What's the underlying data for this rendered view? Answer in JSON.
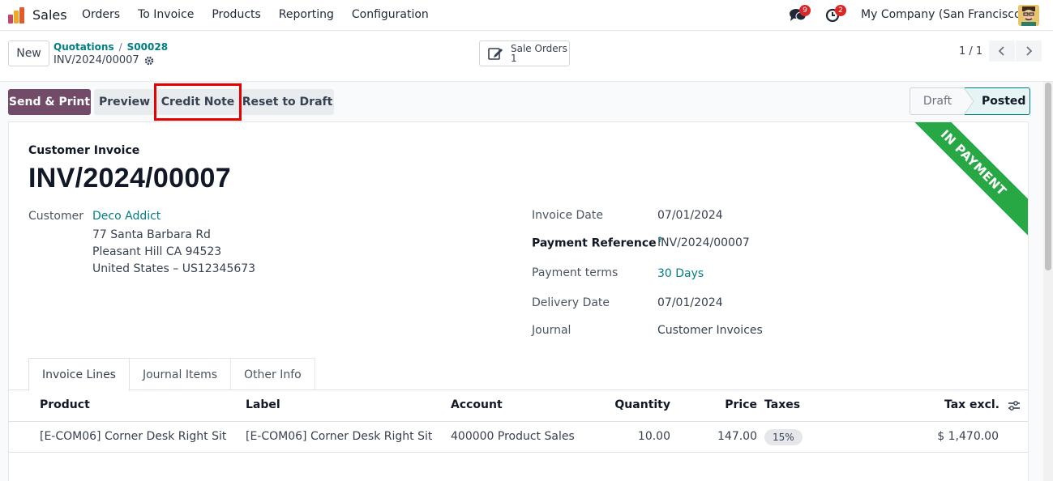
{
  "navbar": {
    "app_name": "Sales",
    "menu": [
      "Orders",
      "To Invoice",
      "Products",
      "Reporting",
      "Configuration"
    ],
    "messages_badge": "9",
    "activities_badge": "2",
    "company": "My Company (San Francisco)"
  },
  "control": {
    "new_label": "New",
    "breadcrumb": [
      "Quotations",
      "S00028"
    ],
    "record_name": "INV/2024/00007",
    "smart_button": {
      "label": "Sale Orders",
      "count": "1"
    },
    "pager": "1 / 1"
  },
  "actions": {
    "send_print": "Send & Print",
    "preview": "Preview",
    "credit_note": "Credit Note",
    "reset_draft": "Reset to Draft"
  },
  "status": {
    "stages": [
      "Draft",
      "Posted"
    ],
    "current": "Posted"
  },
  "sheet": {
    "ribbon": "IN PAYMENT",
    "doc_type": "Customer Invoice",
    "title": "INV/2024/00007",
    "customer_label": "Customer",
    "customer_name": "Deco Addict",
    "address": [
      "77 Santa Barbara Rd",
      "Pleasant Hill CA 94523",
      "United States – US12345673"
    ],
    "fields": {
      "invoice_date": {
        "label": "Invoice Date",
        "value": "07/01/2024"
      },
      "payment_reference": {
        "label": "Payment Reference",
        "help": "?",
        "value": "INV/2024/00007"
      },
      "payment_terms": {
        "label": "Payment terms",
        "value": "30 Days"
      },
      "delivery_date": {
        "label": "Delivery Date",
        "value": "07/01/2024"
      },
      "journal": {
        "label": "Journal",
        "value": "Customer Invoices"
      }
    }
  },
  "tabs": [
    "Invoice Lines",
    "Journal Items",
    "Other Info"
  ],
  "table": {
    "headers": {
      "product": "Product",
      "label": "Label",
      "account": "Account",
      "quantity": "Quantity",
      "price": "Price",
      "taxes": "Taxes",
      "tax_excl": "Tax excl."
    },
    "rows": [
      {
        "product": "[E-COM06] Corner Desk Right Sit",
        "label": "[E-COM06] Corner Desk Right Sit",
        "account": "400000 Product Sales",
        "quantity": "10.00",
        "price": "147.00",
        "taxes": "15%",
        "tax_excl": "$ 1,470.00"
      }
    ]
  },
  "colors": {
    "brand": "#714b67",
    "link": "#017e84",
    "ribbon": "#28a745",
    "highlight": "#e60000"
  }
}
